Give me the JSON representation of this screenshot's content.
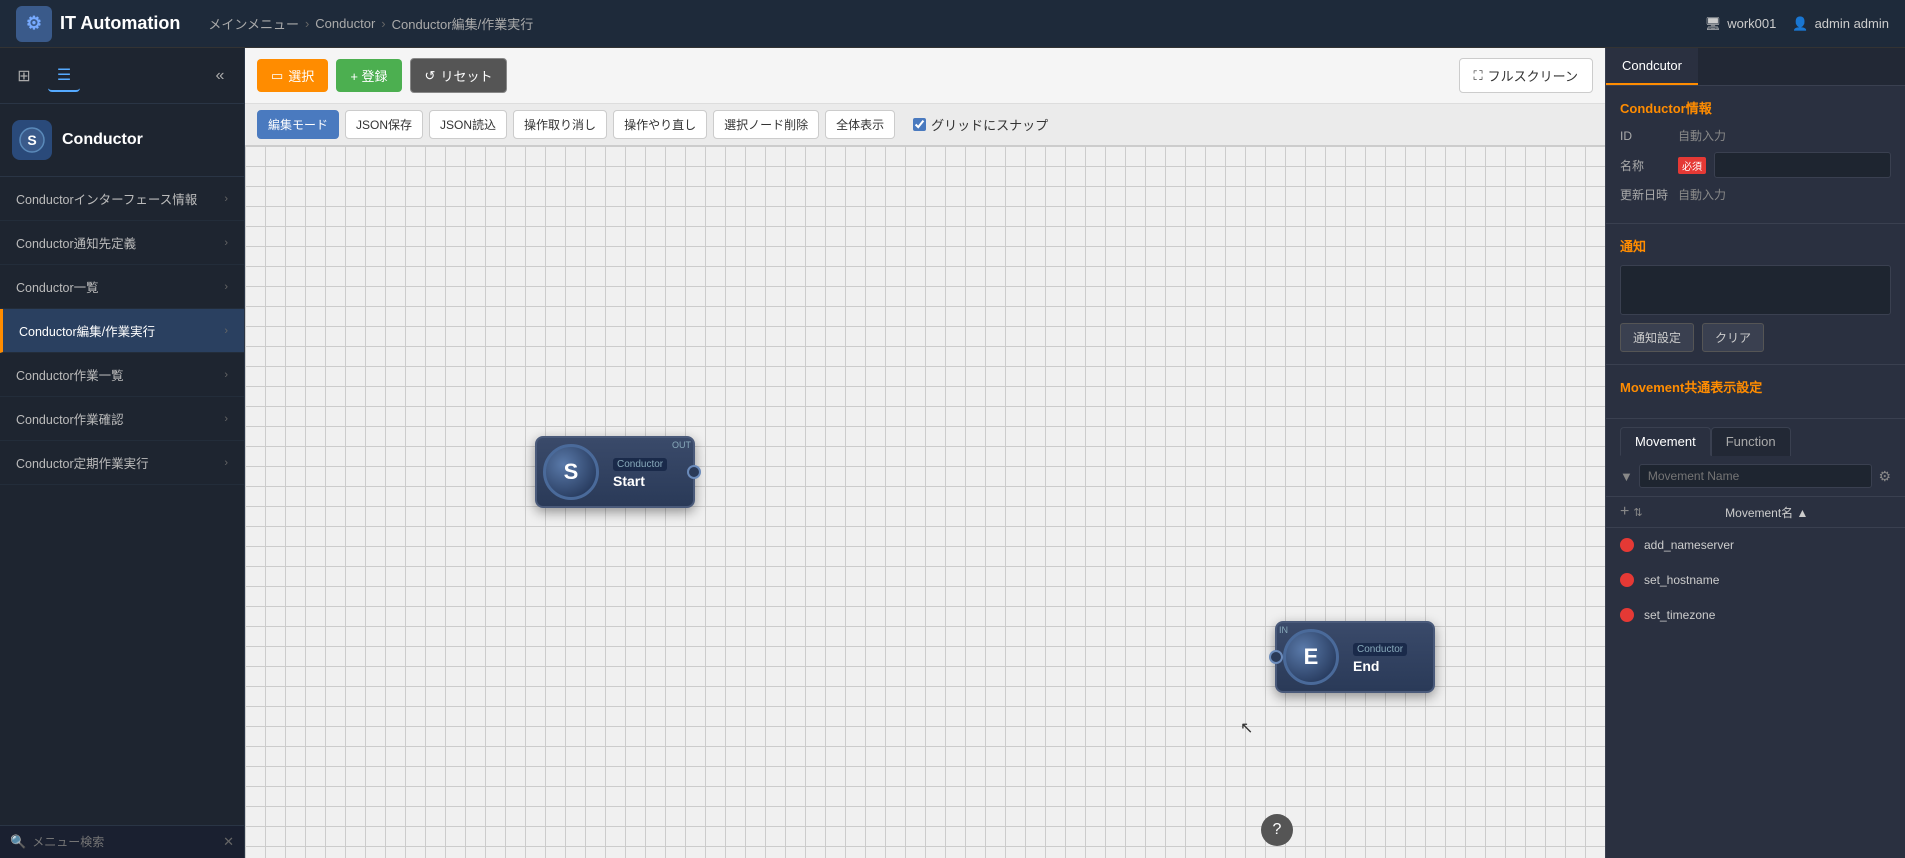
{
  "navbar": {
    "logo_icon": "⚙",
    "title": "IT Automation",
    "breadcrumb": [
      "メインメニュー",
      "Conductor",
      "Conductor編集/作業実行"
    ],
    "workspace_icon": "🖥",
    "workspace": "work001",
    "user_icon": "👤",
    "user": "admin admin"
  },
  "sidebar": {
    "header_icon": "S",
    "header_title": "Conductor",
    "menu_items": [
      {
        "label": "Conductorインターフェース情報",
        "active": false
      },
      {
        "label": "Conductor通知先定義",
        "active": false
      },
      {
        "label": "Conductor一覧",
        "active": false
      },
      {
        "label": "Conductor編集/作業実行",
        "active": true
      },
      {
        "label": "Conductor作業一覧",
        "active": false
      },
      {
        "label": "Conductor作業確認",
        "active": false
      },
      {
        "label": "Conductor定期作業実行",
        "active": false
      }
    ],
    "search_placeholder": "メニュー検索"
  },
  "toolbar": {
    "select_label": "選択",
    "register_label": "+ 登録",
    "reset_label": "リセット",
    "fullscreen_label": "フルスクリーン",
    "edit_mode_label": "編集モード",
    "json_save_label": "JSON保存",
    "json_load_label": "JSON読込",
    "undo_label": "操作取り消し",
    "redo_label": "操作やり直し",
    "delete_node_label": "選択ノード削除",
    "show_all_label": "全体表示",
    "snap_label": "グリッドにスナップ"
  },
  "canvas": {
    "node_start": {
      "label_top": "Conductor",
      "label_out": "OUT",
      "icon_letter": "S",
      "label_main": "Start"
    },
    "node_end": {
      "label_top": "Conductor",
      "label_in": "IN",
      "icon_letter": "E",
      "label_main": "End"
    }
  },
  "right_panel": {
    "tab_label": "Condcutor",
    "section_title": "Conductor情報",
    "field_id_label": "ID",
    "field_id_value": "自動入力",
    "field_name_label": "名称",
    "field_name_required": "必須",
    "field_updated_label": "更新日時",
    "field_updated_value": "自動入力",
    "notification_title": "通知",
    "notify_btn_label": "通知設定",
    "clear_btn_label": "クリア",
    "movement_section_title": "Movement共通表示設定",
    "movement_tab": "Movement",
    "function_tab": "Function",
    "search_placeholder": "Movement Name",
    "add_icon": "+",
    "col_header": "Movement名 ▲",
    "movements": [
      {
        "name": "add_nameserver"
      },
      {
        "name": "set_hostname"
      },
      {
        "name": "set_timezone"
      }
    ]
  }
}
